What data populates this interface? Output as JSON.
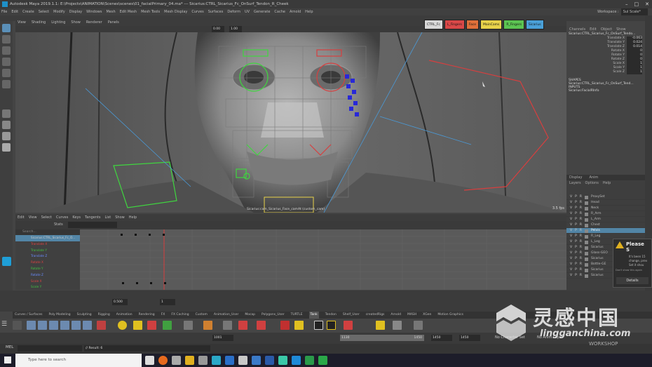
{
  "window": {
    "title": "Autodesk Maya 2019.1.1: E:\\Projects\\ANIMATION\\Scenes\\scenes\\01_facialPrimary_04.ma* --- Sicarius:CTRL_Sicarius_Fc_OnSurf_Tendon_R_Cheek",
    "controls": [
      "–",
      "□",
      "✕"
    ]
  },
  "menubar": {
    "items": [
      "File",
      "Edit",
      "Create",
      "Select",
      "Modify",
      "Display",
      "Windows",
      "Mesh",
      "Edit Mesh",
      "Mesh Tools",
      "Mesh Display",
      "Curves",
      "Surfaces",
      "Deform",
      "UV",
      "Generate",
      "Cache",
      "Arnold",
      "Help"
    ],
    "workspace_label": "Workspace :",
    "workspace_value": "Sul Scale*"
  },
  "viewport": {
    "menu": [
      "View",
      "Shading",
      "Lighting",
      "Show",
      "Renderer",
      "Panels"
    ],
    "field_a": "0.00",
    "field_b": "1.00",
    "quick_buttons": [
      {
        "label": "CTRL_Fc",
        "color": "#d8d8d8"
      },
      {
        "label": "L_Fingers",
        "color": "#d94848"
      },
      {
        "label": "Face",
        "color": "#e0703a"
      },
      {
        "label": "MainCams",
        "color": "#e8d24a"
      },
      {
        "label": "R_Fingers",
        "color": "#5cc452"
      },
      {
        "label": "Sicarius",
        "color": "#4aa0d8"
      }
    ],
    "camera_label": "Sicarius:cam_Sicarius_Face_camAt (custom_cam)",
    "fps": "3.5 fps"
  },
  "channelbox": {
    "tabs": [
      "Channels",
      "Edit",
      "Object",
      "Show"
    ],
    "object_name": "Sicarius:CTRL_Sicarius_Fc_OnSurf_Tendo...",
    "channels": [
      {
        "name": "Translate X",
        "value": "-0.063"
      },
      {
        "name": "Translate Y",
        "value": "0.024"
      },
      {
        "name": "Translate Z",
        "value": "0.014"
      },
      {
        "name": "Rotate X",
        "value": "0"
      },
      {
        "name": "Rotate Y",
        "value": "0"
      },
      {
        "name": "Rotate Z",
        "value": "0"
      },
      {
        "name": "Scale X",
        "value": "1"
      },
      {
        "name": "Scale Y",
        "value": "1"
      },
      {
        "name": "Scale Z",
        "value": "1"
      }
    ],
    "shapes_header": "SHAPES",
    "shapes_item": "Sicarius:CTRL_Sicarius_Fc_OnSurf_Tend...",
    "inputs_header": "INPUTS",
    "inputs_item": "Sicarius:FacialRInfo"
  },
  "layers": {
    "tabs": [
      "Display",
      "Anim"
    ],
    "menu": [
      "Layers",
      "Options",
      "Help"
    ],
    "items": [
      {
        "label": "ProxySet",
        "selected": false
      },
      {
        "label": "Head",
        "selected": false
      },
      {
        "label": "Neck",
        "selected": false
      },
      {
        "label": "R_Arm",
        "selected": false
      },
      {
        "label": "L_Arm",
        "selected": false
      },
      {
        "label": "Chest",
        "selected": false
      },
      {
        "label": "Pelvis",
        "selected": true
      },
      {
        "label": "R_Leg",
        "selected": false
      },
      {
        "label": "L_Leg",
        "selected": false
      },
      {
        "label": "Sicarius",
        "selected": false
      },
      {
        "label": "Glass-GEO",
        "selected": false
      },
      {
        "label": "Sicarius",
        "selected": false
      },
      {
        "label": "Bottle-GE",
        "selected": false
      },
      {
        "label": "Sicarius",
        "selected": false
      },
      {
        "label": "Sicarius",
        "selected": false
      }
    ]
  },
  "popup": {
    "title": "Please S",
    "body": "It's been 15 change, prev Set it shou",
    "checkbox": "Don't show this again",
    "button": "Details"
  },
  "grapheditor": {
    "menu": [
      "Edit",
      "View",
      "Select",
      "Curves",
      "Keys",
      "Tangents",
      "List",
      "Show",
      "Help"
    ],
    "stats_label": "Stats",
    "search_placeholder": "Search...",
    "outliner_items": [
      {
        "label": "Sicarius:CTRL_Sicarius_Fc_O...",
        "color": "#cccccc"
      },
      {
        "label": "Translate X",
        "color": "#e04040"
      },
      {
        "label": "Translate Y",
        "color": "#40c040"
      },
      {
        "label": "Translate Z",
        "color": "#6a8cff"
      },
      {
        "label": "Rotate X",
        "color": "#e04040"
      },
      {
        "label": "Rotate Y",
        "color": "#40c040"
      },
      {
        "label": "Rotate Z",
        "color": "#6a8cff"
      },
      {
        "label": "Scale X",
        "color": "#e04040"
      },
      {
        "label": "Scale Y",
        "color": "#40c040"
      },
      {
        "label": "Scale Z",
        "color": "#6a8cff"
      }
    ]
  },
  "timeline": {
    "field1": "0.500",
    "field2": "1"
  },
  "shelf": {
    "tabs": [
      "Curves / Surfaces",
      "Poly Modeling",
      "Sculpting",
      "Rigging",
      "Animation",
      "Rendering",
      "FX",
      "FX Caching",
      "Custom",
      "Animation_User",
      "Mocap",
      "Polygons_User",
      "TURTLE",
      "Tank",
      "Tendon",
      "Shelf_User",
      "createdRigs",
      "Arnold",
      "MASH",
      "XGen",
      "Motion Graphics"
    ],
    "active_tab": "Tank"
  },
  "bottom": {
    "mel_label": "MEL",
    "result": "// Result: 6",
    "start": "1001",
    "range_start": "1130",
    "range_end": "1450",
    "end": "1450",
    "end2": "1450",
    "char_set": "No Character Set",
    "anim_layer": "No Anim Layer"
  },
  "taskbar": {
    "search_placeholder": "Type here to search"
  },
  "watermark": {
    "chinese": "灵感中国",
    "url": "lingganchina.com",
    "workshop": "WORKSHOP"
  }
}
